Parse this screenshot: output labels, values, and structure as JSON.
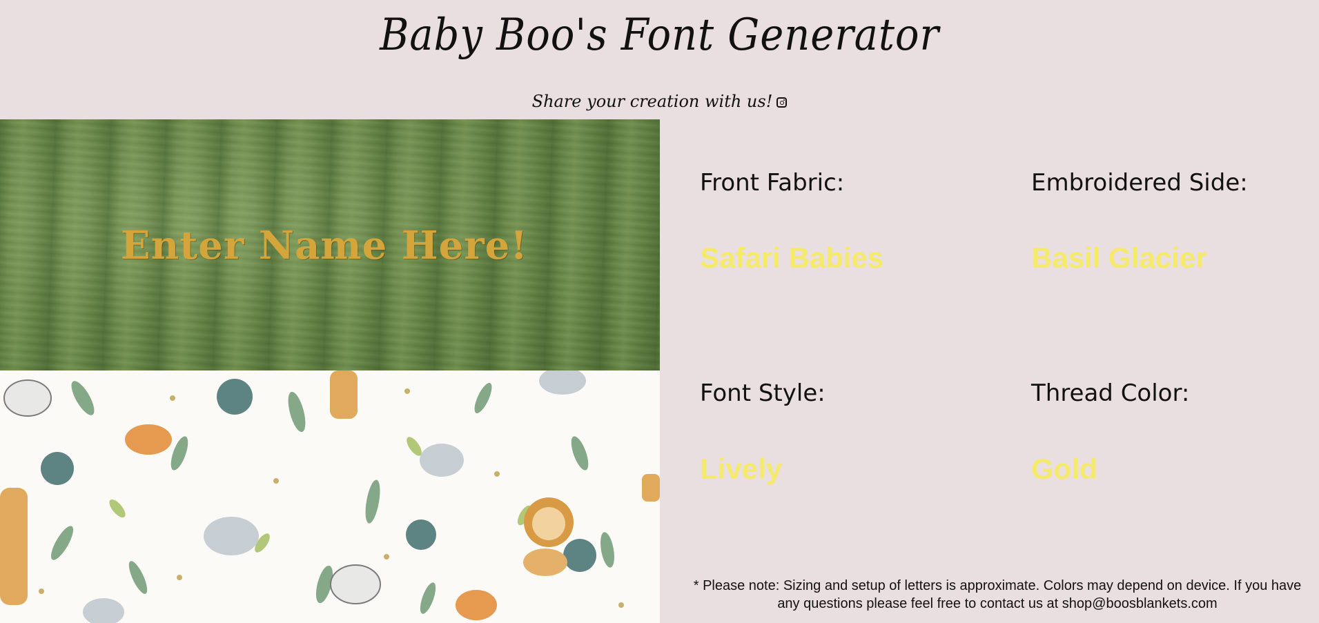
{
  "header": {
    "title": "Baby Boo's Font Generator",
    "subtitle": "Share your creation with us!",
    "subtitle_icon": "instagram-icon"
  },
  "preview": {
    "name_text": "Enter Name Here!",
    "name_color": "#d3a53a",
    "top_fabric_color": "#6c8a4a",
    "bottom_fabric_pattern": "safari-animals"
  },
  "options": {
    "front_fabric": {
      "label": "Front Fabric:",
      "value": "Safari Babies"
    },
    "embroidered_side": {
      "label": "Embroidered Side:",
      "value": "Basil Glacier"
    },
    "font_style": {
      "label": "Font Style:",
      "value": "Lively"
    },
    "thread_color": {
      "label": "Thread Color:",
      "value": "Gold"
    },
    "value_color": "#f5ea6a"
  },
  "note": "* Please note: Sizing and setup of letters is approximate. Colors may depend on device. If you have any questions please feel free to contact us at shop@boosblankets.com"
}
